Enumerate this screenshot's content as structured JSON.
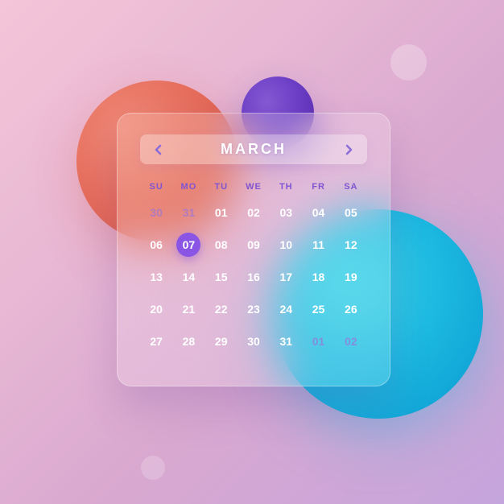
{
  "month": {
    "title": "MARCH"
  },
  "weekdays": [
    "SU",
    "MO",
    "TU",
    "WE",
    "TH",
    "FR",
    "SA"
  ],
  "days": [
    {
      "num": "30",
      "type": "muted"
    },
    {
      "num": "31",
      "type": "muted"
    },
    {
      "num": "01",
      "type": "normal"
    },
    {
      "num": "02",
      "type": "normal"
    },
    {
      "num": "03",
      "type": "normal"
    },
    {
      "num": "04",
      "type": "normal"
    },
    {
      "num": "05",
      "type": "normal"
    },
    {
      "num": "06",
      "type": "normal"
    },
    {
      "num": "07",
      "type": "selected"
    },
    {
      "num": "08",
      "type": "normal"
    },
    {
      "num": "09",
      "type": "normal"
    },
    {
      "num": "10",
      "type": "normal"
    },
    {
      "num": "11",
      "type": "normal"
    },
    {
      "num": "12",
      "type": "normal"
    },
    {
      "num": "13",
      "type": "normal"
    },
    {
      "num": "14",
      "type": "normal"
    },
    {
      "num": "15",
      "type": "normal"
    },
    {
      "num": "16",
      "type": "normal"
    },
    {
      "num": "17",
      "type": "normal"
    },
    {
      "num": "18",
      "type": "normal"
    },
    {
      "num": "19",
      "type": "normal"
    },
    {
      "num": "20",
      "type": "normal"
    },
    {
      "num": "21",
      "type": "normal"
    },
    {
      "num": "22",
      "type": "normal"
    },
    {
      "num": "23",
      "type": "normal"
    },
    {
      "num": "24",
      "type": "normal"
    },
    {
      "num": "25",
      "type": "normal"
    },
    {
      "num": "26",
      "type": "normal"
    },
    {
      "num": "27",
      "type": "normal"
    },
    {
      "num": "28",
      "type": "normal"
    },
    {
      "num": "29",
      "type": "normal"
    },
    {
      "num": "30",
      "type": "normal"
    },
    {
      "num": "31",
      "type": "normal"
    },
    {
      "num": "01",
      "type": "muted"
    },
    {
      "num": "02",
      "type": "muted"
    }
  ]
}
